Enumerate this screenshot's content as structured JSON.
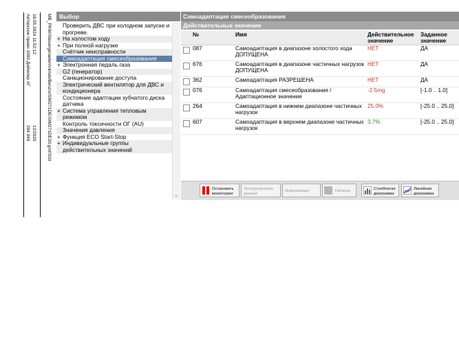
{
  "sidebar_meta": {
    "datetime": "18.05.2024 11:52:12",
    "copyright": "Авторское право 1999 Даймлер АГ",
    "path": "MB_PKW/Steuergeraete/Antrieb/Benzin/SIM271DE/SIM271DE20.gmf/SGI",
    "code1": "12/2020",
    "code2": "204.049"
  },
  "left_panel": {
    "title": "Выбор",
    "items": [
      {
        "label": "Проверить ДВС при холодном запуске и прогреве.",
        "plus": "",
        "state": ""
      },
      {
        "label": "На холостом ходу",
        "plus": "+",
        "state": "alt"
      },
      {
        "label": "При полной нагрузке",
        "plus": "+",
        "state": ""
      },
      {
        "label": "Счётчик неисправности",
        "plus": "",
        "state": "alt"
      },
      {
        "label": "Самоадаптация смесеобразования",
        "plus": "",
        "state": "sel"
      },
      {
        "label": "Электронная педаль газа",
        "plus": "+",
        "state": ""
      },
      {
        "label": "G2 (генератор)",
        "plus": "",
        "state": "alt"
      },
      {
        "label": "Санкционирование доступа",
        "plus": "",
        "state": ""
      },
      {
        "label": "Электрический вентилятор для ДВС и кондиционера",
        "plus": "",
        "state": "alt"
      },
      {
        "label": "Состояние адаптации зубчатого диска датчика",
        "plus": "",
        "state": ""
      },
      {
        "label": "Система управления тепловым режимом",
        "plus": "+",
        "state": "alt"
      },
      {
        "label": "Контроль токсичности ОГ (AU)",
        "plus": "",
        "state": ""
      },
      {
        "label": "Значения давления",
        "plus": "",
        "state": "alt"
      },
      {
        "label": "Функция ECO Start-Stop",
        "plus": "+",
        "state": ""
      },
      {
        "label": "Индивидуальные группы действительных значений",
        "plus": "+",
        "state": "alt"
      }
    ],
    "scroll_arrow": "⌄"
  },
  "right_panel": {
    "title": "Самоадаптация смесеобразования",
    "subtitle": "Действительные значения",
    "columns": {
      "no": "№",
      "name": "Имя",
      "actual": "Действительное значение",
      "target": "Заданное значение"
    },
    "rows": [
      {
        "no": "087",
        "name": "Самоадаптация в диапазоне холостого хода ДОПУЩЕНА",
        "actual": "НЕТ",
        "target": "ДА",
        "status": "bad"
      },
      {
        "no": "676",
        "name": "Самоадаптация в диапазоне частичных нагрузок ДОПУЩЕНА",
        "actual": "НЕТ",
        "target": "ДА",
        "status": "bad"
      },
      {
        "no": "362",
        "name": "Самоадаптация РАЗРЕШЕНА",
        "actual": "НЕТ",
        "target": "ДА",
        "status": "bad"
      },
      {
        "no": "076",
        "name": "Самоадаптация смесеобразования / Адаптационное значение",
        "actual": "-2.5mg",
        "target": "[-1.0 .. 1.0]",
        "status": "bad"
      },
      {
        "no": "264",
        "name": "Самоадаптация в нижнем диапазоне частичных нагрузок",
        "actual": "25.0%",
        "target": "[-25.0 .. 25.0]",
        "status": "bad"
      },
      {
        "no": "607",
        "name": "Самоадаптация в верхнем диапазоне частичных нагрузок",
        "actual": "3.7%",
        "target": "[-25.0 .. 25.0]",
        "status": "ok"
      }
    ]
  },
  "toolbar": {
    "stop": "Остановить мониторинг",
    "export": "Экспортировать данные",
    "info": "Информация",
    "table": "Таблица",
    "bar_chart": "Столбчатая диаграмма",
    "line_chart": "Линейная диаграмма"
  },
  "colors": {
    "header_bg": "#8b8b8b",
    "selected_bg": "#5a7ea8",
    "bad_value": "#c0392b",
    "ok_value": "#2f8f2f"
  }
}
